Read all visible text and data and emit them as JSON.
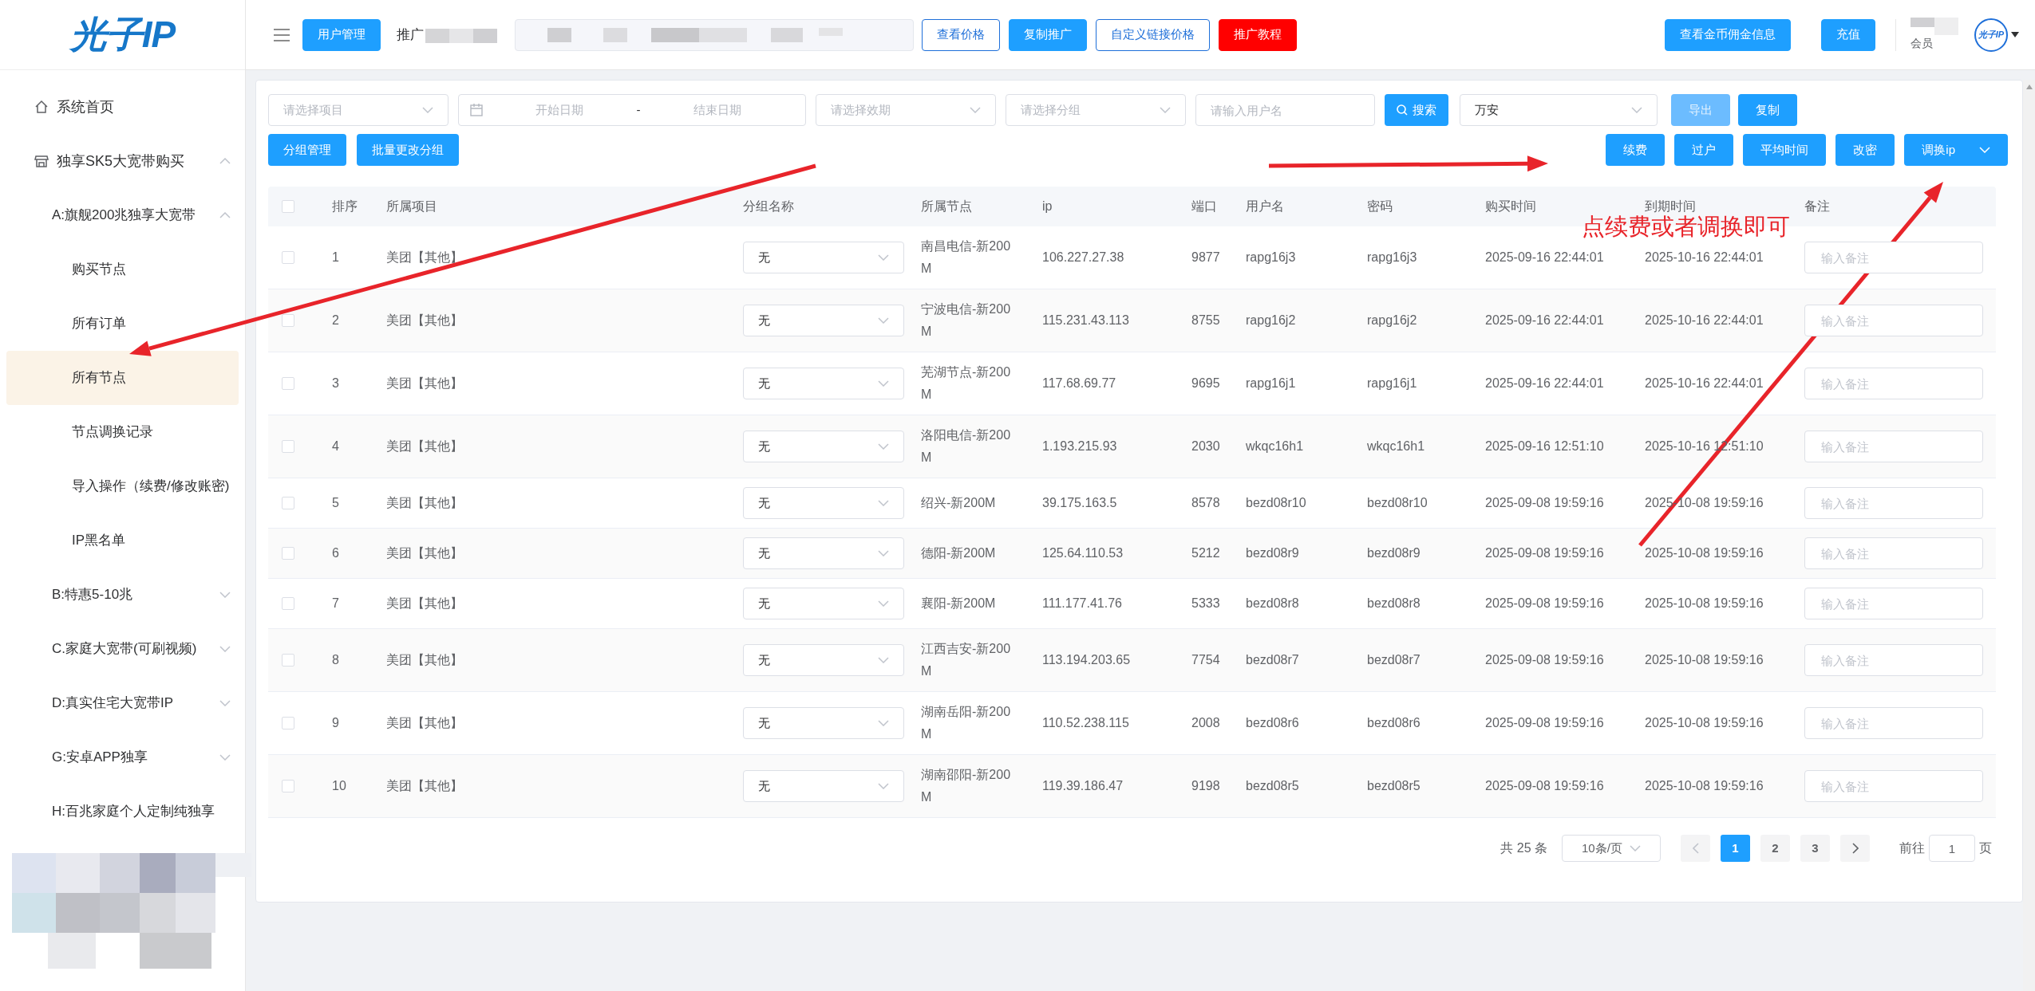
{
  "logo": "光子IP",
  "header": {
    "left_buttons": [
      {
        "label": "用户管理",
        "kind": "primary"
      }
    ],
    "promo_label": "推广",
    "buttons": [
      {
        "label": "查看价格",
        "kind": "outline"
      },
      {
        "label": "复制推广",
        "kind": "primary"
      },
      {
        "label": "自定义链接价格",
        "kind": "outline"
      },
      {
        "label": "推广教程",
        "kind": "danger"
      }
    ],
    "right_buttons": [
      {
        "label": "查看金币佣金信息",
        "kind": "primary"
      },
      {
        "label": "充值",
        "kind": "primary"
      }
    ],
    "user_role": "会员",
    "avatar_text": "光子IP"
  },
  "sidebar": {
    "items": [
      {
        "label": "系统首页",
        "kind": "home",
        "selected": false
      },
      {
        "label": "独享SK5大宽带购买",
        "kind": "store",
        "expanded": true,
        "selected": false,
        "children": [
          {
            "label": "A:旗舰200兆独享大宽带",
            "expanded": true,
            "selected": false,
            "children": [
              {
                "label": "购买节点",
                "selected": false
              },
              {
                "label": "所有订单",
                "selected": false
              },
              {
                "label": "所有节点",
                "selected": true
              },
              {
                "label": "节点调换记录",
                "selected": false
              },
              {
                "label": "导入操作（续费/修改账密)",
                "selected": false
              },
              {
                "label": "IP黑名单",
                "selected": false
              }
            ]
          },
          {
            "label": "B:特惠5-10兆",
            "expanded": false,
            "selected": false
          },
          {
            "label": "C.家庭大宽带(可刷视频)",
            "expanded": false,
            "selected": false
          },
          {
            "label": "D:真实住宅大宽带IP",
            "expanded": false,
            "selected": false
          },
          {
            "label": "G:安卓APP独享",
            "expanded": false,
            "selected": false
          },
          {
            "label": "H:百兆家庭个人定制纯独享",
            "selected": false
          }
        ]
      }
    ]
  },
  "filters": [
    {
      "kind": "select",
      "placeholder": "请选择项目"
    },
    {
      "kind": "daterange",
      "start_placeholder": "开始日期",
      "separator": "-",
      "end_placeholder": "结束日期"
    },
    {
      "kind": "select",
      "placeholder": "请选择效期"
    },
    {
      "kind": "select",
      "placeholder": "请选择分组"
    },
    {
      "kind": "input",
      "placeholder": "请输入用户名"
    }
  ],
  "search_button": "搜索",
  "region_select": "万安",
  "top_actions": [
    {
      "label": "导出",
      "disabled": true
    },
    {
      "label": "复制",
      "disabled": false
    }
  ],
  "left_actions": [
    "分组管理",
    "批量更改分组"
  ],
  "right_actions": [
    {
      "label": "续费",
      "dropdown": false
    },
    {
      "label": "过户",
      "dropdown": false
    },
    {
      "label": "平均时间",
      "dropdown": false
    },
    {
      "label": "改密",
      "dropdown": false
    },
    {
      "label": "调换ip",
      "dropdown": true
    }
  ],
  "table": {
    "all_checked": false,
    "columns": [
      "排序",
      "所属项目",
      "分组名称",
      "所属节点",
      "ip",
      "端口",
      "用户名",
      "密码",
      "购买时间",
      "到期时间",
      "备注"
    ],
    "rows": [
      {
        "checked": false,
        "index": "1",
        "project": "美团【其他】",
        "group": "无",
        "node": "南昌电信-新200M",
        "ip": "106.227.27.38",
        "port": "9877",
        "username": "rapg16j3",
        "password": "rapg16j3",
        "bought": "2025-09-16 22:44:01",
        "expires": "2025-10-16 22:44:01",
        "remark_placeholder": "输入备注"
      },
      {
        "checked": false,
        "index": "2",
        "project": "美团【其他】",
        "group": "无",
        "node": "宁波电信-新200M",
        "ip": "115.231.43.113",
        "port": "8755",
        "username": "rapg16j2",
        "password": "rapg16j2",
        "bought": "2025-09-16 22:44:01",
        "expires": "2025-10-16 22:44:01",
        "remark_placeholder": "输入备注"
      },
      {
        "checked": false,
        "index": "3",
        "project": "美团【其他】",
        "group": "无",
        "node": "芜湖节点-新200M",
        "ip": "117.68.69.77",
        "port": "9695",
        "username": "rapg16j1",
        "password": "rapg16j1",
        "bought": "2025-09-16 22:44:01",
        "expires": "2025-10-16 22:44:01",
        "remark_placeholder": "输入备注"
      },
      {
        "checked": false,
        "index": "4",
        "project": "美团【其他】",
        "group": "无",
        "node": "洛阳电信-新200M",
        "ip": "1.193.215.93",
        "port": "2030",
        "username": "wkqc16h1",
        "password": "wkqc16h1",
        "bought": "2025-09-16 12:51:10",
        "expires": "2025-10-16 12:51:10",
        "remark_placeholder": "输入备注"
      },
      {
        "checked": false,
        "index": "5",
        "project": "美团【其他】",
        "group": "无",
        "node": "绍兴-新200M",
        "ip": "39.175.163.5",
        "port": "8578",
        "username": "bezd08r10",
        "password": "bezd08r10",
        "bought": "2025-09-08 19:59:16",
        "expires": "2025-10-08 19:59:16",
        "remark_placeholder": "输入备注"
      },
      {
        "checked": false,
        "index": "6",
        "project": "美团【其他】",
        "group": "无",
        "node": "德阳-新200M",
        "ip": "125.64.110.53",
        "port": "5212",
        "username": "bezd08r9",
        "password": "bezd08r9",
        "bought": "2025-09-08 19:59:16",
        "expires": "2025-10-08 19:59:16",
        "remark_placeholder": "输入备注"
      },
      {
        "checked": false,
        "index": "7",
        "project": "美团【其他】",
        "group": "无",
        "node": "襄阳-新200M",
        "ip": "111.177.41.76",
        "port": "5333",
        "username": "bezd08r8",
        "password": "bezd08r8",
        "bought": "2025-09-08 19:59:16",
        "expires": "2025-10-08 19:59:16",
        "remark_placeholder": "输入备注"
      },
      {
        "checked": false,
        "index": "8",
        "project": "美团【其他】",
        "group": "无",
        "node": "江西吉安-新200M",
        "ip": "113.194.203.65",
        "port": "7754",
        "username": "bezd08r7",
        "password": "bezd08r7",
        "bought": "2025-09-08 19:59:16",
        "expires": "2025-10-08 19:59:16",
        "remark_placeholder": "输入备注"
      },
      {
        "checked": false,
        "index": "9",
        "project": "美团【其他】",
        "group": "无",
        "node": "湖南岳阳-新200M",
        "ip": "110.52.238.115",
        "port": "2008",
        "username": "bezd08r6",
        "password": "bezd08r6",
        "bought": "2025-09-08 19:59:16",
        "expires": "2025-10-08 19:59:16",
        "remark_placeholder": "输入备注"
      },
      {
        "checked": false,
        "index": "10",
        "project": "美团【其他】",
        "group": "无",
        "node": "湖南邵阳-新200M",
        "ip": "119.39.186.47",
        "port": "9198",
        "username": "bezd08r5",
        "password": "bezd08r5",
        "bought": "2025-09-08 19:59:16",
        "expires": "2025-10-08 19:59:16",
        "remark_placeholder": "输入备注"
      }
    ]
  },
  "pagination": {
    "total": "共 25 条",
    "page_size": "10条/页",
    "pages": [
      {
        "label": "1",
        "selected": true
      },
      {
        "label": "2",
        "selected": false
      },
      {
        "label": "3",
        "selected": false
      }
    ],
    "goto_label": "前往",
    "goto_value": "1",
    "page_suffix": "页"
  },
  "annotation": "点续费或者调换即可"
}
